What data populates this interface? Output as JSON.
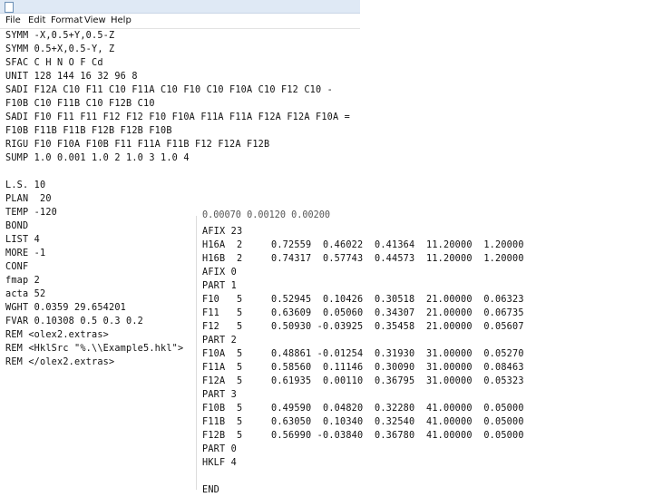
{
  "window1": {
    "menu": [
      "File",
      "Edit",
      "Format",
      "View",
      "Help"
    ],
    "lines": [
      "SYMM -X,0.5+Y,0.5-Z",
      "SYMM 0.5+X,0.5-Y, Z",
      "SFAC C H N O F Cd",
      "UNIT 128 144 16 32 96 8",
      "SADI F12A C10 F11 C10 F11A C10 F10 C10 F10A C10 F12 C10 -",
      "F10B C10 F11B C10 F12B C10",
      "SADI F10 F11 F11 F12 F12 F10 F10A F11A F11A F12A F12A F10A =",
      "F10B F11B F11B F12B F12B F10B",
      "RIGU F10 F10A F10B F11 F11A F11B F12 F12A F12B",
      "SUMP 1.0 0.001 1.0 2 1.0 3 1.0 4",
      "",
      "L.S. 10",
      "PLAN  20",
      "TEMP -120",
      "BOND",
      "LIST 4",
      "MORE -1",
      "CONF",
      "fmap 2",
      "acta 52",
      "WGHT 0.0359 29.654201",
      "FVAR 0.10308 0.5 0.3 0.2",
      "REM <olex2.extras>",
      "REM <HklSrc \"%.\\\\Example5.hkl\">",
      "REM </olex2.extras>"
    ]
  },
  "window2": {
    "cut_line": "0.00070 0.00120 0.00200",
    "lines": [
      "AFIX 23",
      "H16A  2     0.72559  0.46022  0.41364  11.20000  1.20000",
      "H16B  2     0.74317  0.57743  0.44573  11.20000  1.20000",
      "AFIX 0",
      "PART 1",
      "F10   5     0.52945  0.10426  0.30518  21.00000  0.06323",
      "F11   5     0.63609  0.05060  0.34307  21.00000  0.06735",
      "F12   5     0.50930 -0.03925  0.35458  21.00000  0.05607",
      "PART 2",
      "F10A  5     0.48861 -0.01254  0.31930  31.00000  0.05270",
      "F11A  5     0.58560  0.11146  0.30090  31.00000  0.08463",
      "F12A  5     0.61935  0.00110  0.36795  31.00000  0.05323",
      "PART 3",
      "F10B  5     0.49590  0.04820  0.32280  41.00000  0.05000",
      "F11B  5     0.63050  0.10340  0.32540  41.00000  0.05000",
      "F12B  5     0.56990 -0.03840  0.36780  41.00000  0.05000",
      "PART 0",
      "HKLF 4",
      "",
      "END"
    ]
  }
}
